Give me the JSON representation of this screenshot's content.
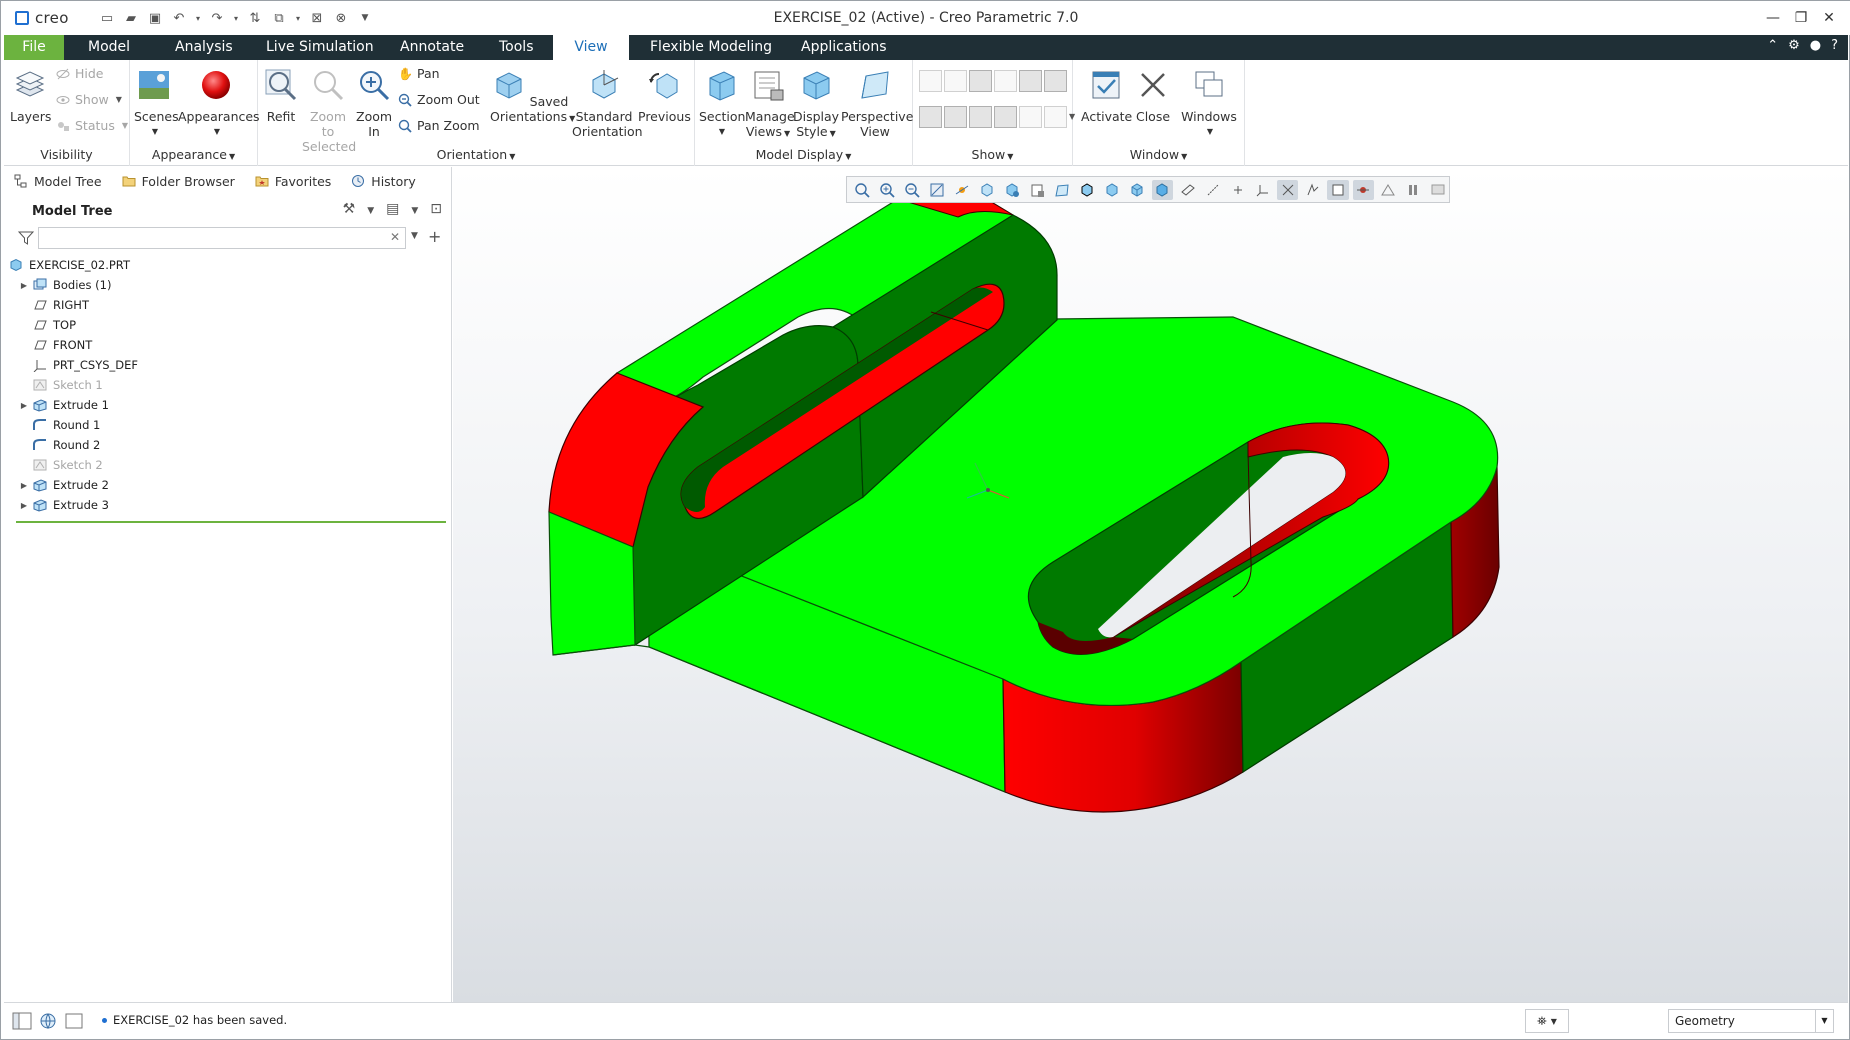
{
  "app": {
    "logo_text": "creo",
    "window_title": "EXERCISE_02 (Active) - Creo Parametric 7.0"
  },
  "tabs": [
    {
      "label": "File"
    },
    {
      "label": "Model"
    },
    {
      "label": "Analysis"
    },
    {
      "label": "Live Simulation"
    },
    {
      "label": "Annotate"
    },
    {
      "label": "Tools"
    },
    {
      "label": "View"
    },
    {
      "label": "Flexible Modeling"
    },
    {
      "label": "Applications"
    }
  ],
  "active_tab": "View",
  "ribbon": {
    "visibility": {
      "group_label": "Visibility",
      "layers": "Layers",
      "hide": "Hide",
      "show": "Show",
      "status": "Status"
    },
    "appearance": {
      "group_label": "Appearance",
      "scenes": "Scenes",
      "appearances": "Appearances"
    },
    "orientation": {
      "group_label": "Orientation",
      "refit": "Refit",
      "zoom_to_selected_1": "Zoom to",
      "zoom_to_selected_2": "Selected",
      "zoom_in_1": "Zoom",
      "zoom_in_2": "In",
      "pan": "Pan",
      "zoom_out": "Zoom Out",
      "pan_zoom": "Pan Zoom",
      "saved_orientations_1": "Saved",
      "saved_orientations_2": "Orientations",
      "standard_orientation_1": "Standard",
      "standard_orientation_2": "Orientation",
      "previous": "Previous"
    },
    "model_display": {
      "group_label": "Model Display",
      "section": "Section",
      "manage_views_1": "Manage",
      "manage_views_2": "Views",
      "display_style_1": "Display",
      "display_style_2": "Style",
      "perspective_view_1": "Perspective",
      "perspective_view_2": "View"
    },
    "show": {
      "group_label": "Show"
    },
    "window": {
      "group_label": "Window",
      "activate": "Activate",
      "close": "Close",
      "windows": "Windows"
    }
  },
  "left_panel": {
    "tabs": [
      {
        "label": "Model Tree"
      },
      {
        "label": "Folder Browser"
      },
      {
        "label": "Favorites"
      },
      {
        "label": "History"
      }
    ],
    "tree_title": "Model Tree",
    "filter_value": "",
    "tree": [
      {
        "label": "EXERCISE_02.PRT",
        "expandable": false,
        "dim": false
      },
      {
        "label": "Bodies (1)",
        "expandable": true,
        "dim": false
      },
      {
        "label": "RIGHT",
        "expandable": false,
        "dim": false
      },
      {
        "label": "TOP",
        "expandable": false,
        "dim": false
      },
      {
        "label": "FRONT",
        "expandable": false,
        "dim": false
      },
      {
        "label": "PRT_CSYS_DEF",
        "expandable": false,
        "dim": false
      },
      {
        "label": "Sketch 1",
        "expandable": false,
        "dim": true
      },
      {
        "label": "Extrude 1",
        "expandable": true,
        "dim": false
      },
      {
        "label": "Round 1",
        "expandable": false,
        "dim": false
      },
      {
        "label": "Round 2",
        "expandable": false,
        "dim": false
      },
      {
        "label": "Sketch 2",
        "expandable": false,
        "dim": true
      },
      {
        "label": "Extrude 2",
        "expandable": true,
        "dim": false
      },
      {
        "label": "Extrude 3",
        "expandable": true,
        "dim": false
      }
    ]
  },
  "status_bar": {
    "message": "EXERCISE_02 has been saved.",
    "selection_filter": "Geometry"
  },
  "colors": {
    "accent_green": "#6cb33f",
    "tab_bar": "#1f2f36",
    "model_green": "#00ff00",
    "model_dark_green": "#007a00",
    "model_red": "#ff0000",
    "model_dark_red": "#7a0000"
  }
}
